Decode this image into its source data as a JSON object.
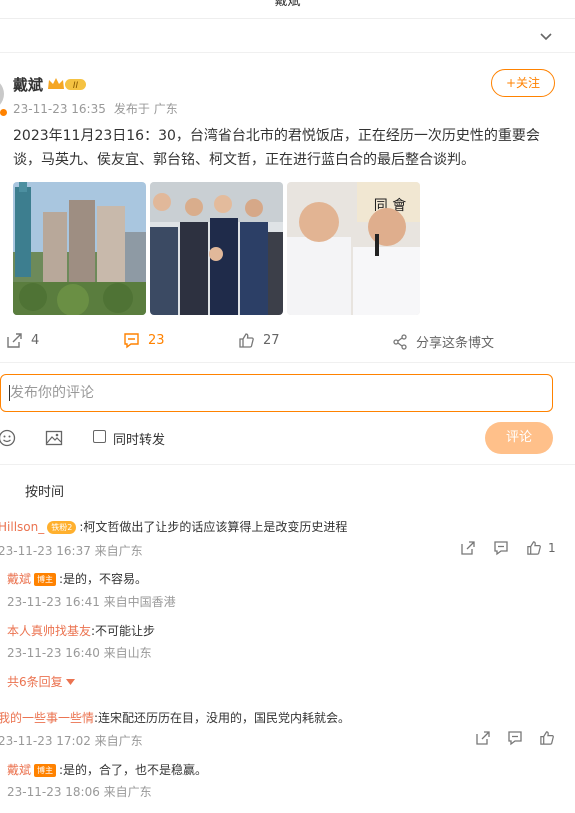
{
  "header": {
    "title": "戴斌"
  },
  "post": {
    "author": "戴斌",
    "level_badge": "II",
    "time": "23-11-23 16:35",
    "source": "发布于 广东",
    "follow_label": "+关注",
    "text": "2023年11月23日16：30，台湾省台北市的君悦饭店，正在经历一次历史性的重要会谈，马英九、侯友宜、郭台铭、柯文哲，正在进行蓝白合的最后整合谈判。",
    "photos": [
      {
        "icon": "city-skyline-photo"
      },
      {
        "icon": "group-handshake-photo"
      },
      {
        "icon": "two-politicians-photo"
      }
    ],
    "actions": {
      "repost_count": "4",
      "comment_count": "23",
      "like_count": "27",
      "share_label": "分享这条博文"
    }
  },
  "composer": {
    "placeholder": "发布你的评论",
    "repost_label": "同时转发",
    "submit_label": "评论"
  },
  "sort_label": "按时间",
  "comments": [
    {
      "name": "Hillson_",
      "badge": "铁粉2",
      "text": ":柯文哲做出了让步的话应该算得上是改变历史进程",
      "time": "23-11-23 16:37 来自广东",
      "like_count": "1",
      "replies": [
        {
          "name": "戴斌",
          "badge": "博主",
          "text": ":是的，不容易。",
          "time": "23-11-23 16:41 来自中国香港"
        },
        {
          "name": "本人真帅找基友",
          "text": ":不可能让步",
          "time": "23-11-23 16:40 来自山东"
        }
      ],
      "more_label": "共6条回复"
    },
    {
      "name": "我的一些事一些情",
      "text": ":连宋配还历历在目，没用的，国民党内耗就会。",
      "time": "23-11-23 17:02 来自广东",
      "replies": [
        {
          "name": "戴斌",
          "badge": "博主",
          "text": ":是的，合了，也不是稳赢。",
          "time": "23-11-23 18:06 来自广东"
        }
      ]
    }
  ],
  "colors": {
    "accent": "#ff8200",
    "name": "#eb7350",
    "submit_disabled": "#ffc08a"
  }
}
